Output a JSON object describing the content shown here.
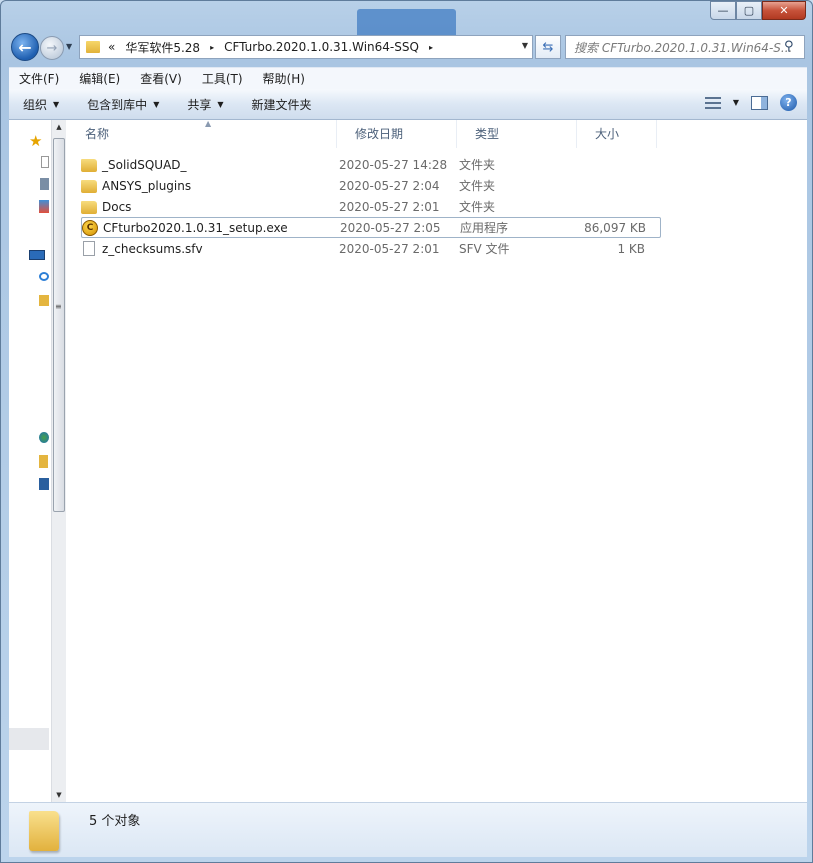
{
  "window": {
    "caption_buttons": [
      "minimize",
      "maximize",
      "close"
    ]
  },
  "address": {
    "prefix": "«",
    "segments": [
      "华军软件5.28",
      "CFTurbo.2020.1.0.31.Win64-SSQ"
    ],
    "separator": "▸"
  },
  "search": {
    "placeholder": "搜索 CFTurbo.2020.1.0.31.Win64-S..."
  },
  "menu": {
    "items": [
      "文件(F)",
      "编辑(E)",
      "查看(V)",
      "工具(T)",
      "帮助(H)"
    ]
  },
  "toolbar": {
    "organize": "组织",
    "include_library": "包含到库中",
    "share": "共享",
    "new_folder": "新建文件夹"
  },
  "columns": {
    "name": "名称",
    "date": "修改日期",
    "type": "类型",
    "size": "大小"
  },
  "files": [
    {
      "name": "_SolidSQUAD_",
      "date": "2020-05-27 14:28",
      "type": "文件夹",
      "size": "",
      "icon": "folder-icon"
    },
    {
      "name": "ANSYS_plugins",
      "date": "2020-05-27 2:04",
      "type": "文件夹",
      "size": "",
      "icon": "folder-icon"
    },
    {
      "name": "Docs",
      "date": "2020-05-27 2:01",
      "type": "文件夹",
      "size": "",
      "icon": "folder-icon"
    },
    {
      "name": "CFturbo2020.1.0.31_setup.exe",
      "date": "2020-05-27 2:05",
      "type": "应用程序",
      "size": "86,097 KB",
      "icon": "installer-icon"
    },
    {
      "name": "z_checksums.sfv",
      "date": "2020-05-27 2:01",
      "type": "SFV 文件",
      "size": "1 KB",
      "icon": "file-icon"
    }
  ],
  "status": {
    "count": "5 个对象"
  },
  "colors": {
    "frame": "#b8d0e8",
    "close_button": "#c7523a",
    "selection_border": "#9fb3c8",
    "folder": "#e0ae35"
  }
}
